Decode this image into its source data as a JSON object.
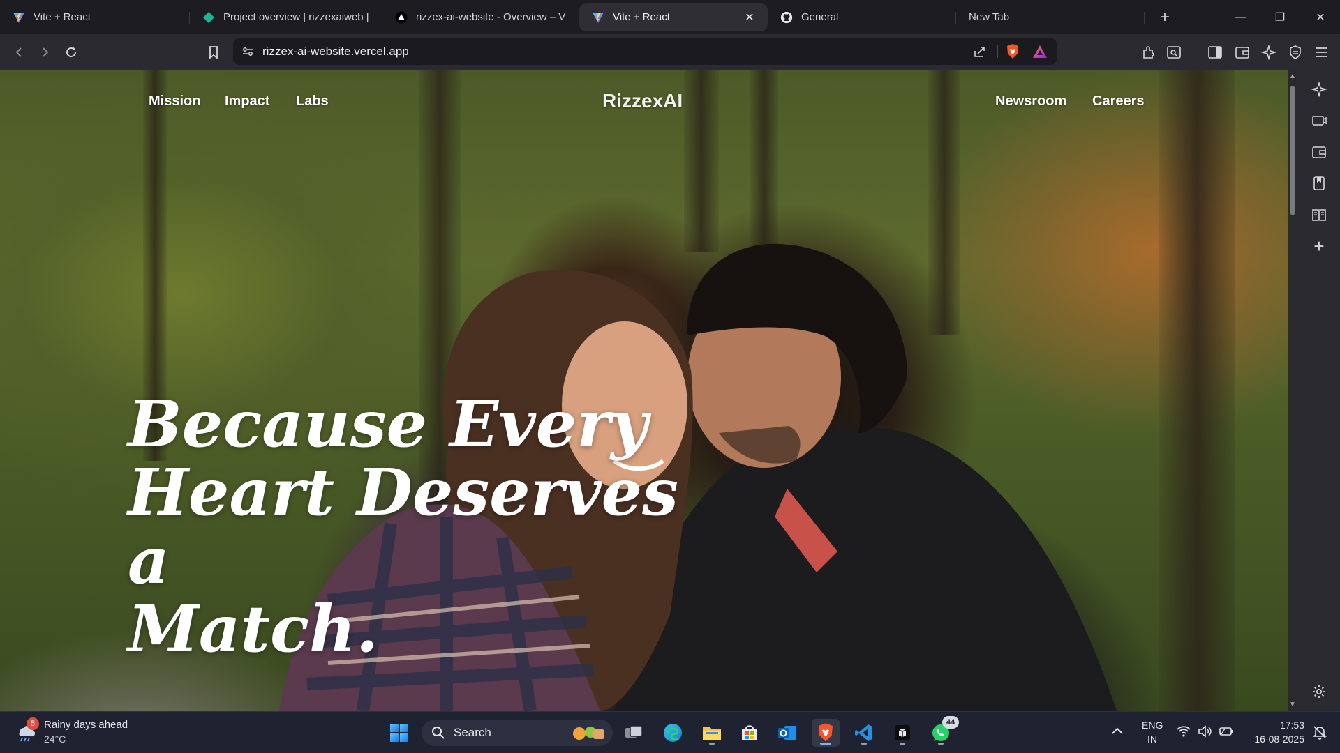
{
  "browser": {
    "tabs": [
      {
        "title": "Vite + React",
        "favicon": "vite-icon",
        "active": false
      },
      {
        "title": "Project overview | rizzexaiweb | N",
        "favicon": "firebase-diamond-icon",
        "active": false
      },
      {
        "title": "rizzex-ai-website - Overview – V",
        "favicon": "vercel-triangle-icon",
        "active": false
      },
      {
        "title": "Vite + React",
        "favicon": "vite-icon",
        "active": true
      },
      {
        "title": "General",
        "favicon": "github-icon",
        "active": false
      },
      {
        "title": "New Tab",
        "favicon": "",
        "active": false
      }
    ],
    "new_tab_symbol": "+",
    "window_controls": {
      "minimize": "—",
      "restore": "❐",
      "close": "✕"
    },
    "close_tab_symbol": "✕",
    "address_bar": {
      "url": "rizzex-ai-website.vercel.app"
    }
  },
  "site": {
    "nav_left": [
      "Mission",
      "Impact",
      "Labs"
    ],
    "brand": "RizzexAI",
    "nav_right": [
      "Newsroom",
      "Careers"
    ],
    "hero_lines": [
      "Because Every",
      "Heart Deserves a",
      "Match."
    ]
  },
  "taskbar": {
    "weather": {
      "badge": "5",
      "headline": "Rainy days ahead",
      "temp": "24°C"
    },
    "search_label": "Search",
    "whatsapp_badge": "44",
    "language": {
      "line1": "ENG",
      "line2": "IN"
    },
    "clock": {
      "time": "17:53",
      "date": "16-08-2025"
    }
  },
  "colors": {
    "tabstrip_bg": "#1c1c21",
    "toolbar_bg": "#2a2a30",
    "taskbar_bg": "#1f2230",
    "brave_orange": "#fb542b",
    "accent_blue": "#7fb0ff"
  }
}
